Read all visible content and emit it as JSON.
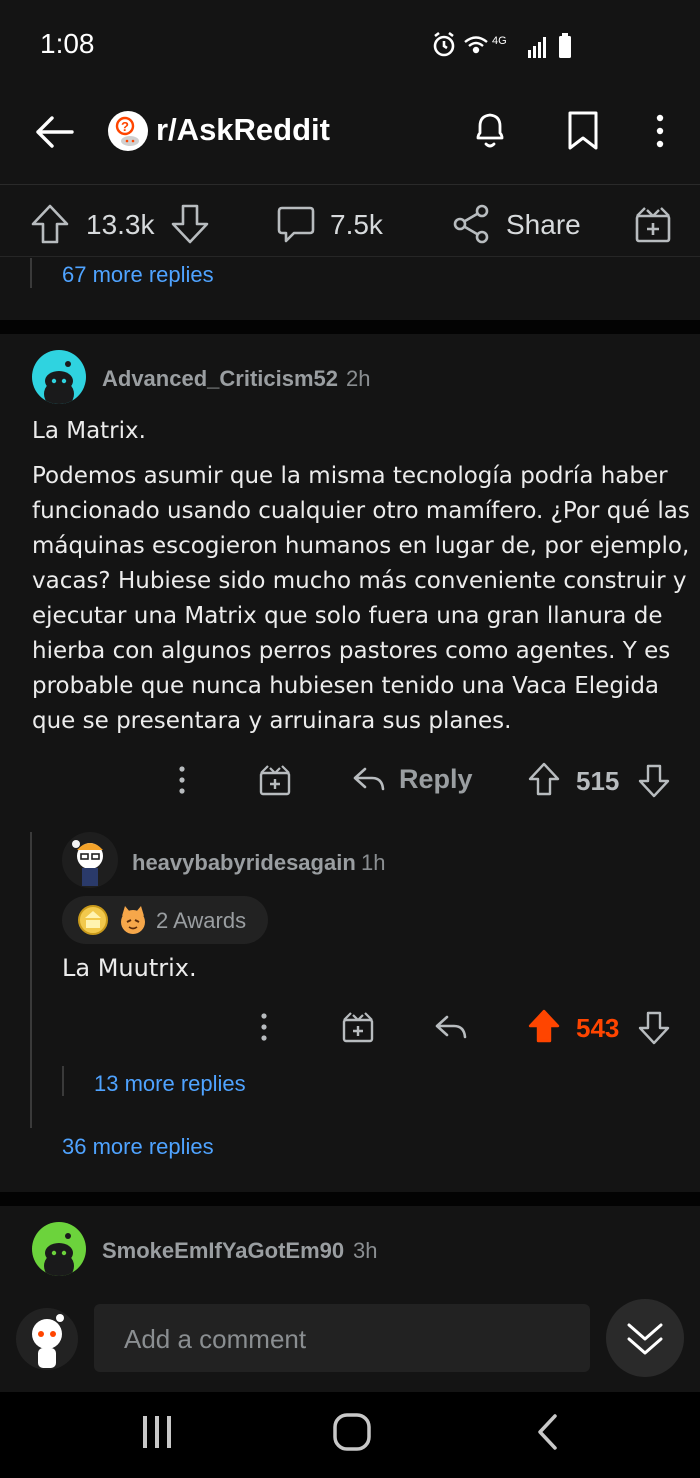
{
  "status_bar": {
    "time": "1:08",
    "network": "4G"
  },
  "header": {
    "back_icon": "arrow-left-icon",
    "subreddit": "r/AskReddit",
    "icons": [
      "bell-icon",
      "bookmark-icon",
      "more-vertical-icon"
    ]
  },
  "post_actions": {
    "upvotes": "13.3k",
    "comments": "7.5k",
    "share_label": "Share"
  },
  "prev_thread": {
    "more_replies": "67 more replies"
  },
  "comment1": {
    "username": "Advanced_Criticism52",
    "time": "2h",
    "paragraph1": "La Matrix.",
    "paragraph2_lines": [
      "Podemos asumir que la misma tecnología podría haber",
      "funcionado usando cualquier otro mamífero. ¿Por qué las",
      "máquinas escogieron humanos en lugar de, por ejemplo,",
      "vacas? Hubiese sido mucho más conveniente construir y",
      "ejecutar una Matrix que solo fuera una gran llanura de",
      "hierba con algunos perros pastores como agentes. Y es",
      "probable que nunca hubiesen tenido una Vaca Elegida",
      "que se presentara y arruinara sus planes."
    ],
    "reply_label": "Reply",
    "score": "515",
    "avatar_color": "#2fd3e0"
  },
  "reply1": {
    "username": "heavybabyridesagain",
    "time": "1h",
    "awards": "2 Awards",
    "text": "La Muutrix.",
    "score": "543",
    "more_replies": "13 more replies"
  },
  "comment1_more": "36 more replies",
  "comment2": {
    "username": "SmokeEmIfYaGotEm90",
    "time": "3h",
    "avatar_color": "#6cd33c"
  },
  "bottom_bar": {
    "placeholder": "Add a comment"
  },
  "colors": {
    "accent_blue": "#4fa3ff",
    "upvote_orange": "#ff4500",
    "background": "#141414"
  }
}
